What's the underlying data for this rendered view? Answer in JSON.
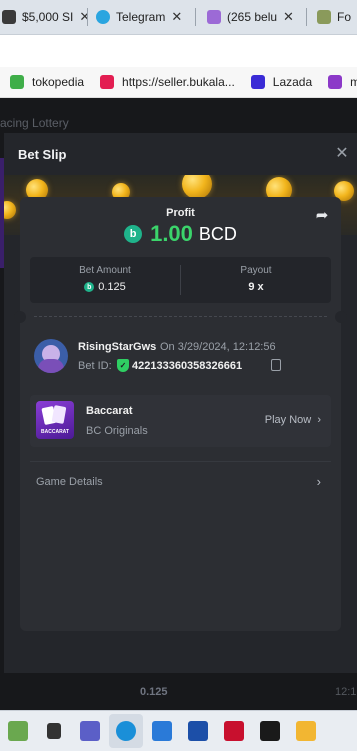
{
  "browser": {
    "tabs": [
      {
        "label": "$5,000 SI",
        "close": "✕",
        "icon": "dollar-favicon-icon",
        "color": "#3a3a3a"
      },
      {
        "label": "Telegram",
        "close": "✕",
        "icon": "telegram-icon",
        "color": "#2aa5e0"
      },
      {
        "label": "(265 belu",
        "close": "✕",
        "icon": "mail-icon",
        "color": "#9c6ad6"
      },
      {
        "label": "Fo",
        "close": "",
        "icon": "tab-favicon-icon",
        "color": "#8a9a5b"
      }
    ],
    "bookmarks": [
      {
        "label": "tokopedia",
        "icon": "tokopedia-icon",
        "color": "#3fae49"
      },
      {
        "label": "https://seller.bukala...",
        "icon": "bukalapak-icon",
        "color": "#e31e52"
      },
      {
        "label": "Lazada",
        "icon": "lazada-icon",
        "color": "#3a2bd6"
      },
      {
        "label": "m",
        "icon": "mail-bookmark-icon",
        "color": "#8c39c8"
      }
    ]
  },
  "background_page": {
    "nav": "acing      Lottery",
    "bottom_amount": "0.125",
    "bottom_right": "12:1"
  },
  "modal": {
    "title": "Bet Slip",
    "profit_label": "Profit",
    "profit_value": "1.00",
    "currency": "BCD",
    "currency_icon": "bcd-coin-icon",
    "bet_amount_label": "Bet Amount",
    "bet_amount_value": "0.125",
    "payout_label": "Payout",
    "payout_value": "9 x",
    "username": "RisingStarGws",
    "date_text": "On 3/29/2024, 12:12:56",
    "bet_id_label": "Bet ID:",
    "bet_id_value": "422133360358326661",
    "game_name": "Baccarat",
    "game_provider": "BC Originals",
    "play_now": "Play Now",
    "game_details": "Game Details",
    "thumb_text": "BACCARAT",
    "colors": {
      "profit": "#3bd46b",
      "accent_coin": "#1fb38b",
      "panel": "#2c2e33"
    }
  },
  "taskbar": {
    "icons": [
      {
        "name": "explorer-icon",
        "color": "#6aa84f"
      },
      {
        "name": "desktop-icon",
        "color": "#333333"
      },
      {
        "name": "teams-icon",
        "color": "#5b5fc7"
      },
      {
        "name": "edge-icon",
        "color": "#1a8fd8"
      },
      {
        "name": "store-icon",
        "color": "#2a7ad8"
      },
      {
        "name": "l-app-icon",
        "color": "#1c4fa8"
      },
      {
        "name": "mcafee-icon",
        "color": "#c8102e"
      },
      {
        "name": "dropbox-icon",
        "color": "#1a1a1a"
      },
      {
        "name": "folder-icon",
        "color": "#f2b632"
      }
    ]
  }
}
